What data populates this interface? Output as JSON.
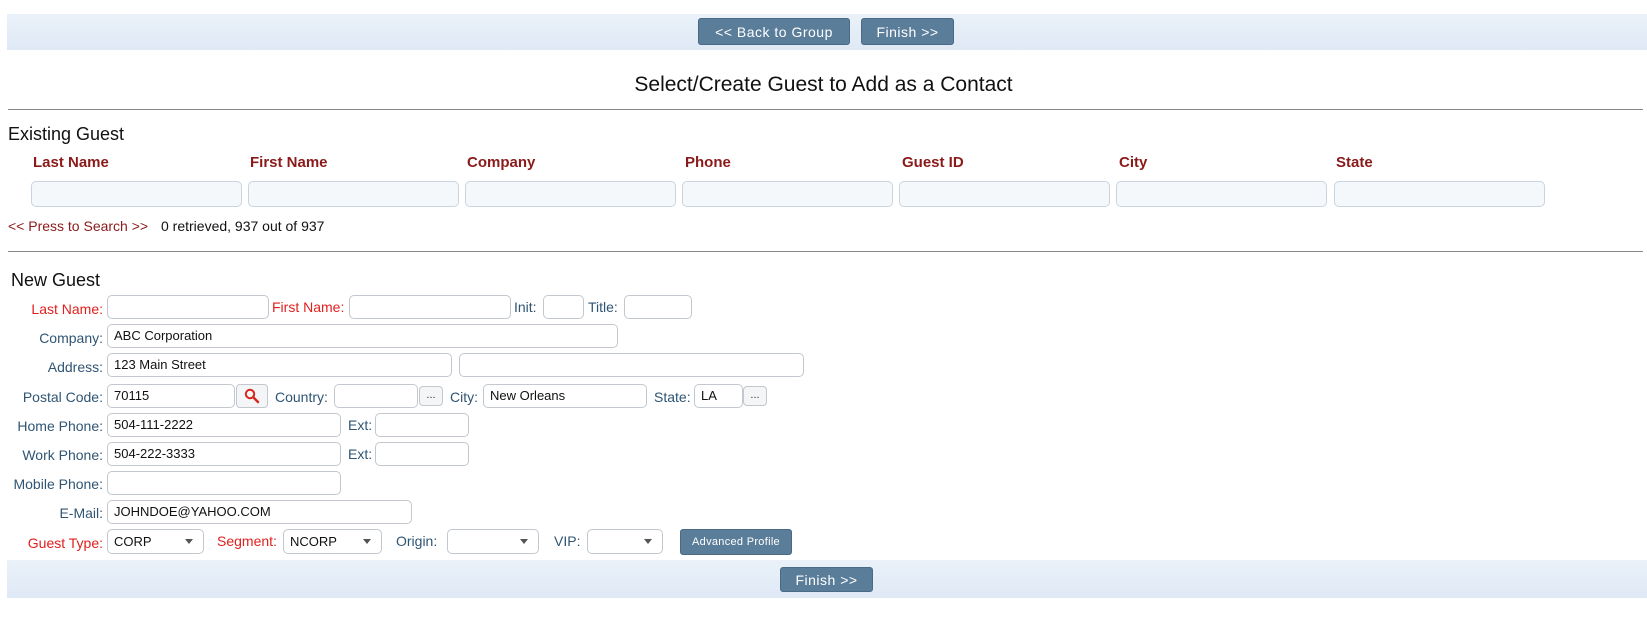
{
  "top_bar": {
    "back_label": "<< Back to Group",
    "finish_label": "Finish >>"
  },
  "page_title": "Select/Create Guest to Add as a Contact",
  "existing_guest": {
    "heading": "Existing Guest",
    "columns": [
      "Last Name",
      "First Name",
      "Company",
      "Phone",
      "Guest ID",
      "City",
      "State"
    ],
    "search_link": "<< Press to Search >>",
    "result_text": "0 retrieved, 937 out of 937"
  },
  "new_guest": {
    "heading": "New Guest",
    "labels": {
      "last_name": "Last Name:",
      "first_name": "First Name:",
      "init": "Init:",
      "title": "Title:",
      "company": "Company:",
      "address": "Address:",
      "postal_code": "Postal Code:",
      "country": "Country:",
      "city": "City:",
      "state": "State:",
      "home_phone": "Home Phone:",
      "ext": "Ext:",
      "work_phone": "Work Phone:",
      "mobile_phone": "Mobile Phone:",
      "email": "E-Mail:",
      "guest_type": "Guest Type:",
      "segment": "Segment:",
      "origin": "Origin:",
      "vip": "VIP:"
    },
    "values": {
      "last_name": "",
      "first_name": "",
      "init": "",
      "title": "",
      "company": "ABC Corporation",
      "address1": "123 Main Street",
      "address2": "",
      "postal_code": "70115",
      "country": "",
      "city": "New Orleans",
      "state": "LA",
      "home_phone": "504-111-2222",
      "home_ext": "",
      "work_phone": "504-222-3333",
      "work_ext": "",
      "mobile_phone": "",
      "email": "JOHNDOE@YAHOO.COM",
      "guest_type": "CORP",
      "segment": "NCORP",
      "origin": "",
      "vip": ""
    },
    "ellipsis": "...",
    "advanced_profile_label": "Advanced Profile"
  },
  "bottom_bar": {
    "finish_label": "Finish >>"
  },
  "colors": {
    "bar": "#e3ecf7",
    "button": "#5a7d9a",
    "header_red": "#8b1a1a",
    "required_red": "#e0201e",
    "label_blue": "#2f5573"
  },
  "icons": {
    "postal_search": "search-icon"
  }
}
